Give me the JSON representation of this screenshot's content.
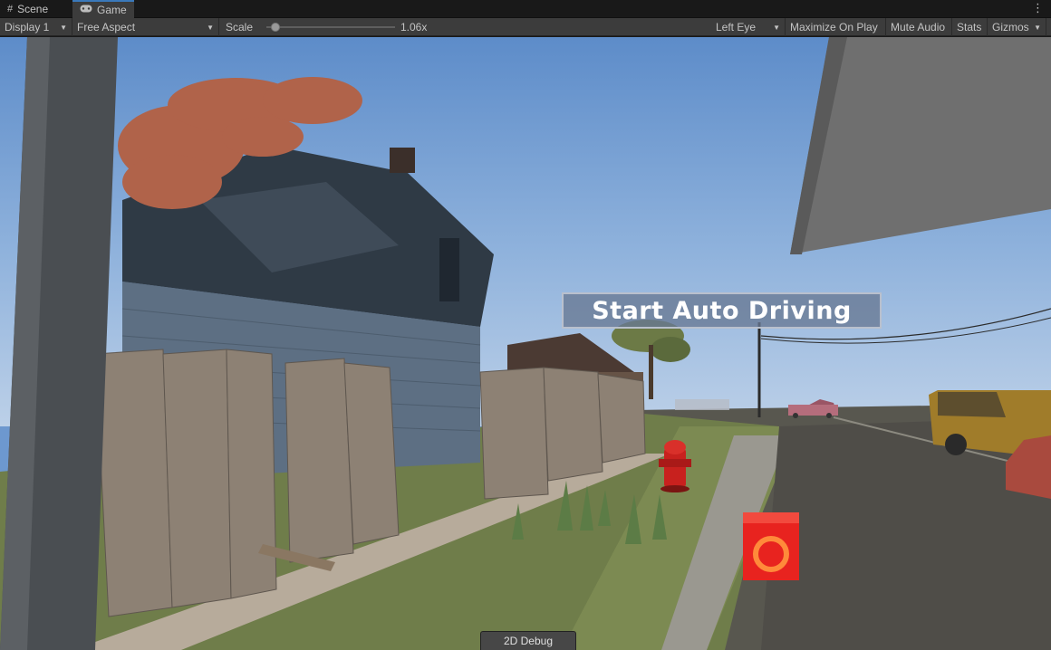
{
  "tabs": [
    {
      "label": "Scene",
      "icon": "grid-icon"
    },
    {
      "label": "Game",
      "icon": "gamepad-icon",
      "active": true
    }
  ],
  "toolbar": {
    "display": "Display 1",
    "aspect": "Free Aspect",
    "scale_label": "Scale",
    "scale_value": "1.06x",
    "scale_fraction": 0.06,
    "eye": "Left Eye",
    "maximize": "Maximize On Play",
    "mute": "Mute Audio",
    "stats": "Stats",
    "gizmos": "Gizmos"
  },
  "game": {
    "start_button": "Start Auto Driving",
    "debug_button": "2D Debug"
  },
  "colors": {
    "accent": "#3a79bb",
    "sky": "#6d98cf",
    "button_bg": "#687894",
    "marker": "#e8231f"
  }
}
